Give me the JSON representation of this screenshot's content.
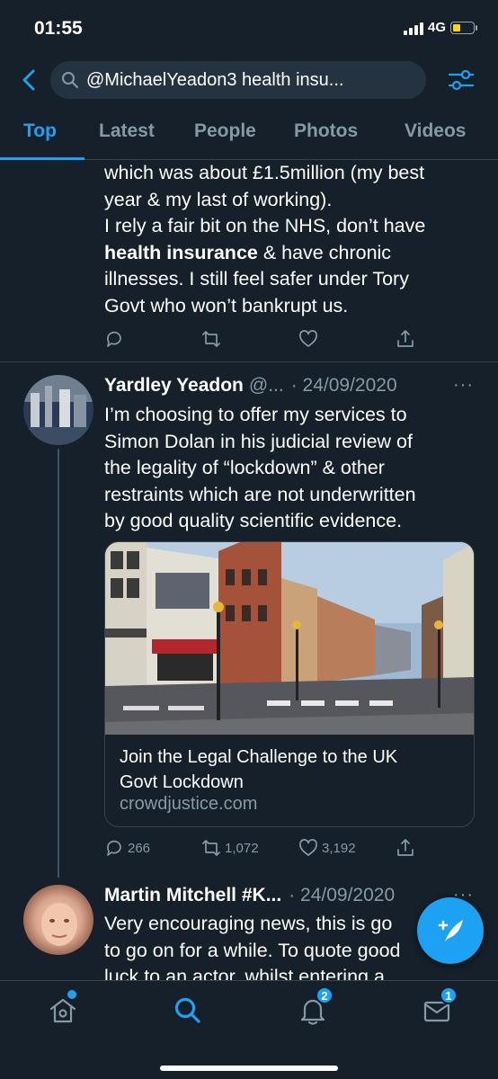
{
  "status_bar": {
    "time": "01:55",
    "network": "4G"
  },
  "search": {
    "query": "@MichaelYeadon3 health insu..."
  },
  "tabs": [
    {
      "label": "Top",
      "active": true
    },
    {
      "label": "Latest",
      "active": false
    },
    {
      "label": "People",
      "active": false
    },
    {
      "label": "Photos",
      "active": false
    },
    {
      "label": "Videos",
      "active": false
    }
  ],
  "tweet1": {
    "line1": "which was about £1.5million (my best",
    "line2": "year & my last of working).",
    "line3": "I rely a fair bit on the NHS, don’t have",
    "line4_bold": "health insurance",
    "line4_rest": " & have chronic",
    "line5": "illnesses. I still feel safer under Tory",
    "line6": "Govt who won’t bankrupt us."
  },
  "tweet2": {
    "name": "Yardley Yeadon",
    "handle": "@...",
    "date": "· 24/09/2020",
    "more": "···",
    "lines": [
      "I’m choosing to offer my services to",
      "Simon Dolan in his judicial review of",
      "the legality of “lockdown” & other",
      "restraints which are not underwritten",
      "by good quality scientific evidence."
    ],
    "card": {
      "title_line1": "Join the Legal Challenge to the UK",
      "title_line2": "Govt Lockdown",
      "domain": "crowdjustice.com"
    },
    "replies": "266",
    "retweets": "1,072",
    "likes": "3,192"
  },
  "tweet3": {
    "name": "Martin Mitchell #K...",
    "date": "· 24/09/2020",
    "more": "···",
    "line1": "Very encouraging news, this is go",
    "line2": "to go on for a while. To quote good",
    "line3": "luck to an actor, whilst entering a"
  },
  "bottom_nav": {
    "notifications_badge": "2",
    "messages_badge": "1"
  },
  "colors": {
    "accent": "#1da1f2",
    "background": "#15202b",
    "muted": "#8899a6"
  }
}
